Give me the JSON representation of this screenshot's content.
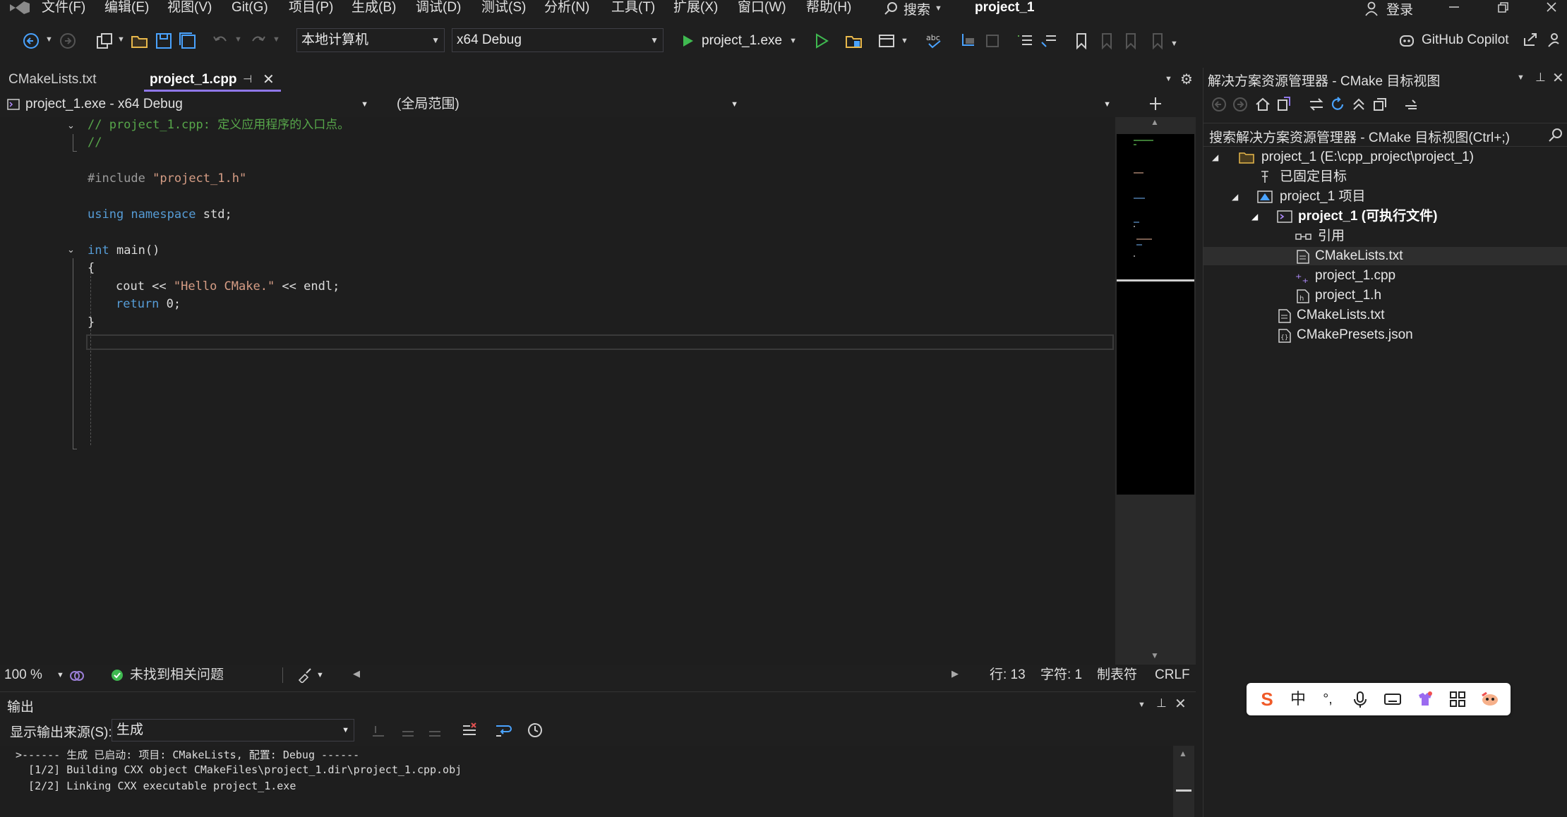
{
  "menu": {
    "items": [
      "文件(F)",
      "编辑(E)",
      "视图(V)",
      "Git(G)",
      "项目(P)",
      "生成(B)",
      "调试(D)",
      "测试(S)",
      "分析(N)",
      "工具(T)",
      "扩展(X)",
      "窗口(W)",
      "帮助(H)"
    ],
    "search_label": "搜索",
    "solution_name": "project_1",
    "login_label": "登录"
  },
  "toolbar": {
    "target_combo": "本地计算机",
    "config_combo": "x64 Debug",
    "run_label": "project_1.exe",
    "copilot_label": "GitHub Copilot"
  },
  "tabs": [
    {
      "label": "CMakeLists.txt",
      "active": false
    },
    {
      "label": "project_1.cpp",
      "active": true
    }
  ],
  "navbar": {
    "project_combo": "project_1.exe - x64 Debug",
    "scope_combo": "(全局范围)"
  },
  "code": {
    "line1_comment": "// project_1.cpp: 定义应用程序的入口点。",
    "line2_comment": "//",
    "include_directive": "#include",
    "include_file": "\"project_1.h\"",
    "using_kw": "using namespace",
    "using_rest": " std;",
    "int_kw": "int",
    "main_sig": " main()",
    "open_brace": "{",
    "cout_start": "cout << ",
    "cout_str": "\"Hello CMake.\"",
    "cout_end": " << endl;",
    "return_kw": "return",
    "return_val": " 0;",
    "close_brace": "}"
  },
  "editor_status": {
    "zoom": "100 %",
    "issues": "未找到相关问题",
    "line": "行: 13",
    "char": "字符: 1",
    "tabs": "制表符",
    "eol": "CRLF"
  },
  "solution_explorer": {
    "title": "解决方案资源管理器 - CMake 目标视图",
    "search_placeholder": "搜索解决方案资源管理器 - CMake 目标视图(Ctrl+;)",
    "items": [
      {
        "label": "project_1 (E:\\cpp_project\\project_1)"
      },
      {
        "label": "已固定目标"
      },
      {
        "label": "project_1 项目"
      },
      {
        "label": "project_1 (可执行文件)"
      },
      {
        "label": "引用"
      },
      {
        "label": "CMakeLists.txt"
      },
      {
        "label": "project_1.cpp"
      },
      {
        "label": "project_1.h"
      },
      {
        "label": "CMakeLists.txt"
      },
      {
        "label": "CMakePresets.json"
      }
    ]
  },
  "output": {
    "title": "输出",
    "source_label": "显示输出来源(S):",
    "source_value": "生成",
    "lines": [
      ">------ 生成 已启动: 项目: CMakeLists, 配置: Debug ------",
      "  [1/2] Building CXX object CMakeFiles\\project_1.dir\\project_1.cpp.obj",
      "  [2/2] Linking CXX executable project_1.exe"
    ]
  },
  "ime": {
    "lang_label": "中",
    "punct_label": "°,"
  },
  "colors": {
    "accent": "#8f77e8",
    "keyword": "#569cd6",
    "comment": "#57a64a",
    "string": "#d69d85",
    "run_green": "#3fb950"
  }
}
